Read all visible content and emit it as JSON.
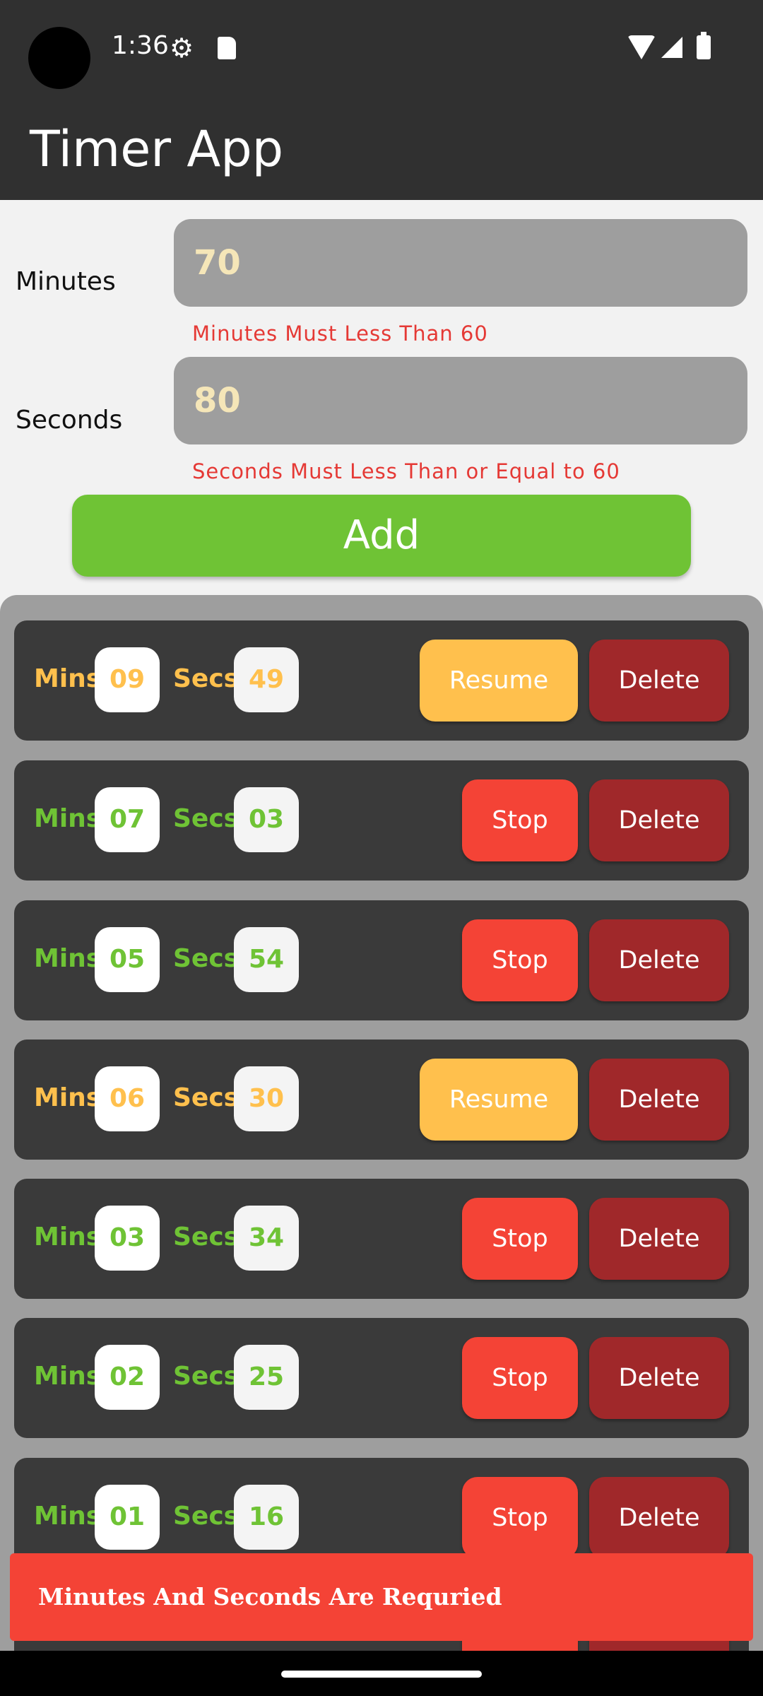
{
  "status_bar": {
    "time": "1:36",
    "icons": [
      "settings-icon",
      "sd-card-icon",
      "wifi-icon",
      "signal-icon",
      "battery-icon"
    ]
  },
  "app_bar": {
    "title": "Timer App"
  },
  "form": {
    "minutes_label": "Minutes",
    "minutes_value": "70",
    "minutes_error": "Minutes Must Less Than 60",
    "seconds_label": "Seconds",
    "seconds_value": "80",
    "seconds_error": "Seconds Must Less Than or Equal to 60",
    "add_label": "Add"
  },
  "labels": {
    "mins": "Mins",
    "secs": "Secs",
    "resume": "Resume",
    "stop": "Stop",
    "delete": "Delete"
  },
  "timers": [
    {
      "mins": "09",
      "secs": "49",
      "state": "paused",
      "action": "Resume"
    },
    {
      "mins": "07",
      "secs": "03",
      "state": "running",
      "action": "Stop"
    },
    {
      "mins": "05",
      "secs": "54",
      "state": "running",
      "action": "Stop"
    },
    {
      "mins": "06",
      "secs": "30",
      "state": "paused",
      "action": "Resume"
    },
    {
      "mins": "03",
      "secs": "34",
      "state": "running",
      "action": "Stop"
    },
    {
      "mins": "02",
      "secs": "25",
      "state": "running",
      "action": "Stop"
    },
    {
      "mins": "01",
      "secs": "16",
      "state": "running",
      "action": "Stop"
    }
  ],
  "snackbar": {
    "message": "Minutes And Seconds Are Requried"
  },
  "colors": {
    "running": "#6fc335",
    "paused": "#ffc04d",
    "stop": "#f44336",
    "delete": "#a0282a",
    "add": "#6fc335"
  }
}
